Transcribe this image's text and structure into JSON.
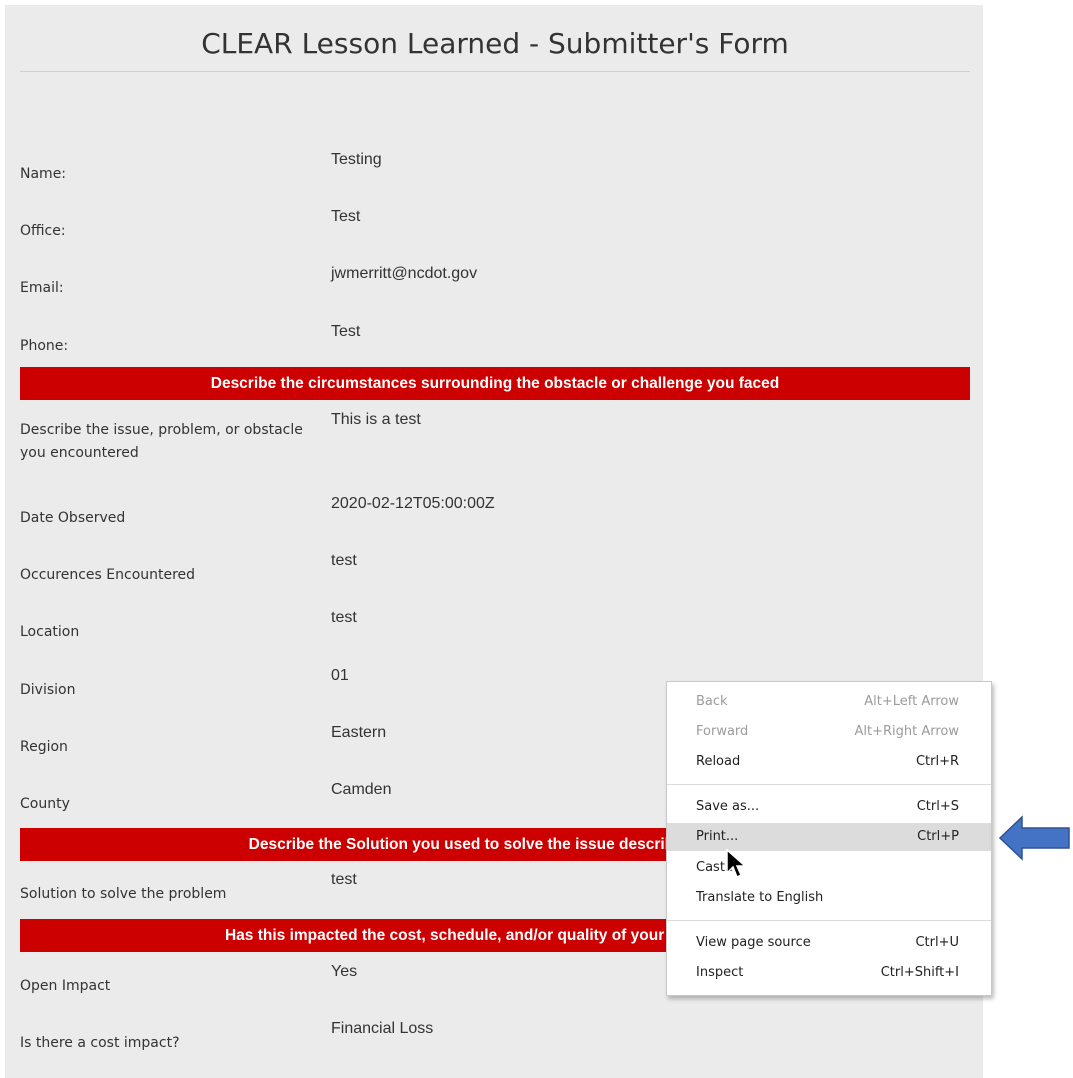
{
  "form": {
    "title": "CLEAR Lesson Learned - Submitter's Form",
    "fields": [
      {
        "label": "Name:",
        "value": "Testing"
      },
      {
        "label": "Office:",
        "value": "Test"
      },
      {
        "label": "Email:",
        "value": "jwmerritt@ncdot.gov"
      },
      {
        "label": "Phone:",
        "value": "Test"
      }
    ],
    "section1_banner": "Describe the circumstances surrounding the obstacle or challenge you faced",
    "section1_fields": [
      {
        "label": "Describe the issue, problem, or obstacle you encountered",
        "value": "This is a test"
      },
      {
        "label": "Date Observed",
        "value": "2020-02-12T05:00:00Z"
      },
      {
        "label": "Occurences Encountered",
        "value": "test"
      },
      {
        "label": "Location",
        "value": "test"
      },
      {
        "label": "Division",
        "value": "01"
      },
      {
        "label": "Region",
        "value": "Eastern"
      },
      {
        "label": "County",
        "value": "Camden"
      }
    ],
    "section2_banner": "Describe the Solution you used to solve the issue described above",
    "section2_fields": [
      {
        "label": "Solution to solve the problem",
        "value": "test"
      }
    ],
    "section3_banner": "Has this impacted the cost, schedule, and/or quality of your own project?",
    "section3_fields": [
      {
        "label": "Open Impact",
        "value": "Yes"
      },
      {
        "label": "Is there a cost impact?",
        "value": "Financial Loss"
      }
    ]
  },
  "context_menu": {
    "items": [
      {
        "label": "Back",
        "shortcut": "Alt+Left Arrow"
      },
      {
        "label": "Forward",
        "shortcut": "Alt+Right Arrow"
      },
      {
        "label": "Reload",
        "shortcut": "Ctrl+R"
      },
      {
        "label": "Save as...",
        "shortcut": "Ctrl+S"
      },
      {
        "label": "Print...",
        "shortcut": "Ctrl+P"
      },
      {
        "label": "Cast...",
        "shortcut": ""
      },
      {
        "label": "Translate to English",
        "shortcut": ""
      },
      {
        "label": "View page source",
        "shortcut": "Ctrl+U"
      },
      {
        "label": "Inspect",
        "shortcut": "Ctrl+Shift+I"
      }
    ]
  },
  "colors": {
    "banner": "#cc0000",
    "panel": "#ebebeb",
    "arrow": "#4472c4",
    "menu_highlight": "#dcdcdc"
  },
  "icons": {
    "pointer": "mouse-cursor-icon",
    "callout": "left-arrow-icon"
  }
}
